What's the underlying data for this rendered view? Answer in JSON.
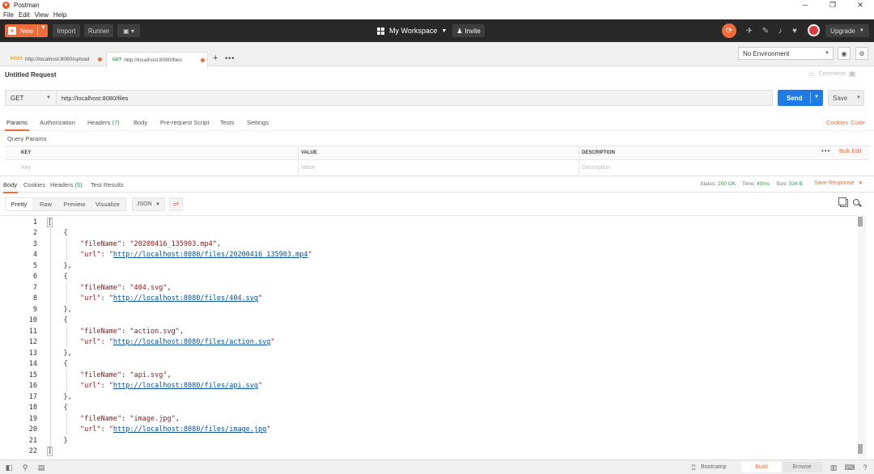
{
  "app": {
    "title": "Postman"
  },
  "menu": [
    "File",
    "Edit",
    "View",
    "Help"
  ],
  "header": {
    "new_label": "New",
    "import_label": "Import",
    "runner_label": "Runner",
    "workspace_label": "My Workspace",
    "invite_label": "Invite",
    "upgrade_label": "Upgrade"
  },
  "tabs": [
    {
      "method": "POST",
      "url": "http://localhost:8080/upload"
    },
    {
      "method": "GET",
      "url": "http://localhost:8080/files"
    }
  ],
  "environment": {
    "selected": "No Environment"
  },
  "request": {
    "name": "Untitled Request",
    "comments_label": "Comments",
    "comments_count": "0",
    "method": "GET",
    "url": "http://localhost:8080/files",
    "send_label": "Send",
    "save_label": "Save"
  },
  "request_tabs": {
    "params": "Params",
    "authorization": "Authorization",
    "headers": "Headers",
    "headers_count": "(7)",
    "body": "Body",
    "prerequest": "Pre-request Script",
    "tests": "Tests",
    "settings": "Settings",
    "cookies": "Cookies",
    "code": "Code"
  },
  "query_params": {
    "label": "Query Params",
    "columns": [
      "KEY",
      "VALUE",
      "DESCRIPTION"
    ],
    "placeholders": [
      "Key",
      "Value",
      "Description"
    ],
    "bulk_edit": "Bulk Edit"
  },
  "response_tabs": {
    "body": "Body",
    "cookies": "Cookies",
    "headers": "Headers",
    "headers_count": "(5)",
    "test_results": "Test Results"
  },
  "response_status": {
    "status_label": "Status:",
    "status_value": "200 OK",
    "time_label": "Time:",
    "time_value": "40ms",
    "size_label": "Size:",
    "size_value": "534 B",
    "save_response": "Save Response"
  },
  "view_modes": [
    "Pretty",
    "Raw",
    "Preview",
    "Visualize"
  ],
  "format": "JSON",
  "files": [
    {
      "fileName": "20200416_135903.mp4",
      "url": "http://localhost:8080/files/20200416_135903.mp4"
    },
    {
      "fileName": "404.svg",
      "url": "http://localhost:8080/files/404.svg"
    },
    {
      "fileName": "action.svg",
      "url": "http://localhost:8080/files/action.svg"
    },
    {
      "fileName": "api.svg",
      "url": "http://localhost:8080/files/api.svg"
    },
    {
      "fileName": "image.jpg",
      "url": "http://localhost:8080/files/image.jpg"
    }
  ],
  "footer": {
    "bootcamp": "Bootcamp",
    "build": "Build",
    "browse": "Browse"
  },
  "colors": {
    "accent": "#f26b3a",
    "send": "#1e7be6",
    "header_bg": "#282828",
    "status_ok": "#2a9d4a"
  }
}
